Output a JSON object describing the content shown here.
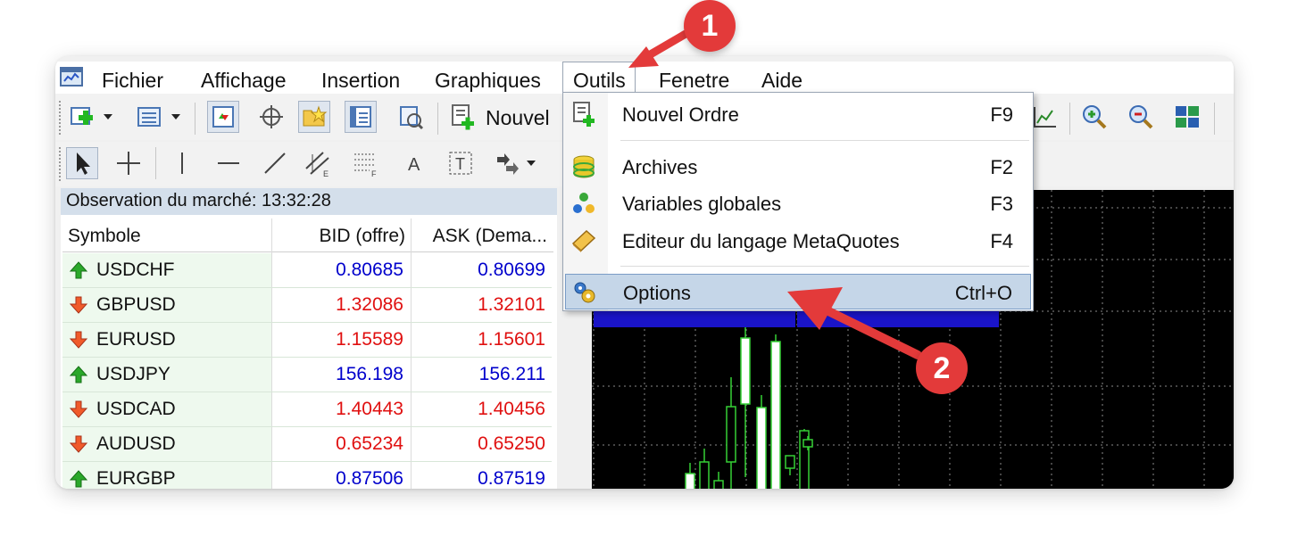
{
  "menu": {
    "items": [
      "Fichier",
      "Affichage",
      "Insertion",
      "Graphiques",
      "Outils",
      "Fenetre",
      "Aide"
    ]
  },
  "toolbar": {
    "new_order_label": "Nouvel"
  },
  "market_watch": {
    "title": "Observation du marché: 13:32:28",
    "columns": [
      "Symbole",
      "BID (offre)",
      "ASK (Dema..."
    ],
    "rows": [
      {
        "symbol": "USDCHF",
        "bid": "0.80685",
        "ask": "0.80699",
        "direction": "up"
      },
      {
        "symbol": "GBPUSD",
        "bid": "1.32086",
        "ask": "1.32101",
        "direction": "down"
      },
      {
        "symbol": "EURUSD",
        "bid": "1.15589",
        "ask": "1.15601",
        "direction": "down"
      },
      {
        "symbol": "USDJPY",
        "bid": "156.198",
        "ask": "156.211",
        "direction": "up"
      },
      {
        "symbol": "USDCAD",
        "bid": "1.40443",
        "ask": "1.40456",
        "direction": "down"
      },
      {
        "symbol": "AUDUSD",
        "bid": "0.65234",
        "ask": "0.65250",
        "direction": "down"
      },
      {
        "symbol": "EURGBP",
        "bid": "0.87506",
        "ask": "0.87519",
        "direction": "up"
      }
    ],
    "colors": {
      "up": "#0000cc",
      "down": "#e01010"
    }
  },
  "tools_menu": {
    "items": [
      {
        "label": "Nouvel Ordre",
        "shortcut": "F9",
        "icon": "new-order-icon"
      },
      {
        "label": "Archives",
        "shortcut": "F2",
        "icon": "archive-database-icon"
      },
      {
        "label": "Variables globales",
        "shortcut": "F3",
        "icon": "global-variables-icon"
      },
      {
        "label": "Editeur du langage MetaQuotes",
        "shortcut": "F4",
        "icon": "metaeditor-icon"
      },
      {
        "label": "Options",
        "shortcut": "Ctrl+O",
        "icon": "options-gear-icon"
      }
    ]
  },
  "annotations": {
    "step1": "1",
    "step2": "2"
  }
}
